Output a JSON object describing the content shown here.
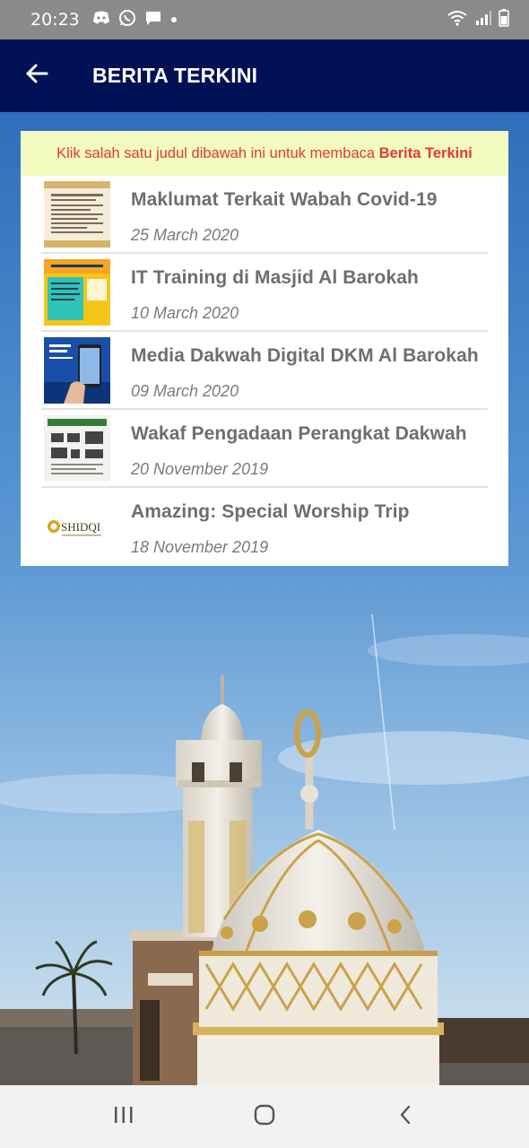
{
  "status_bar": {
    "time": "20:23",
    "left_icons": [
      "discord-icon",
      "whatsapp-icon",
      "message-icon",
      "dot-icon"
    ],
    "right_icons": [
      "wifi-icon",
      "signal-icon",
      "battery-icon"
    ]
  },
  "app_bar": {
    "back_icon": "arrow-left-icon",
    "title": "BERITA TERKINI",
    "color": "#001255"
  },
  "notice": {
    "text": "Klik salah satu judul dibawah ini untuk membaca ",
    "highlight": "Berita Terkini",
    "color": "#e03b36",
    "background": "#f2fabf"
  },
  "news": [
    {
      "title": "Maklumat Terkait Wabah Covid-19",
      "date": "25 March 2020"
    },
    {
      "title": "IT Training di Masjid Al Barokah",
      "date": "10 March 2020"
    },
    {
      "title": "Media Dakwah Digital DKM Al Barokah",
      "date": "09 March 2020"
    },
    {
      "title": "Wakaf Pengadaan Perangkat Dakwah",
      "date": "20 November 2019"
    },
    {
      "title": "Amazing: Special Worship Trip",
      "date": "18 November 2019",
      "thumb_text": "SHIDQI"
    }
  ],
  "nav_bar": {
    "buttons": [
      "recents-icon",
      "home-icon",
      "back-icon"
    ]
  }
}
